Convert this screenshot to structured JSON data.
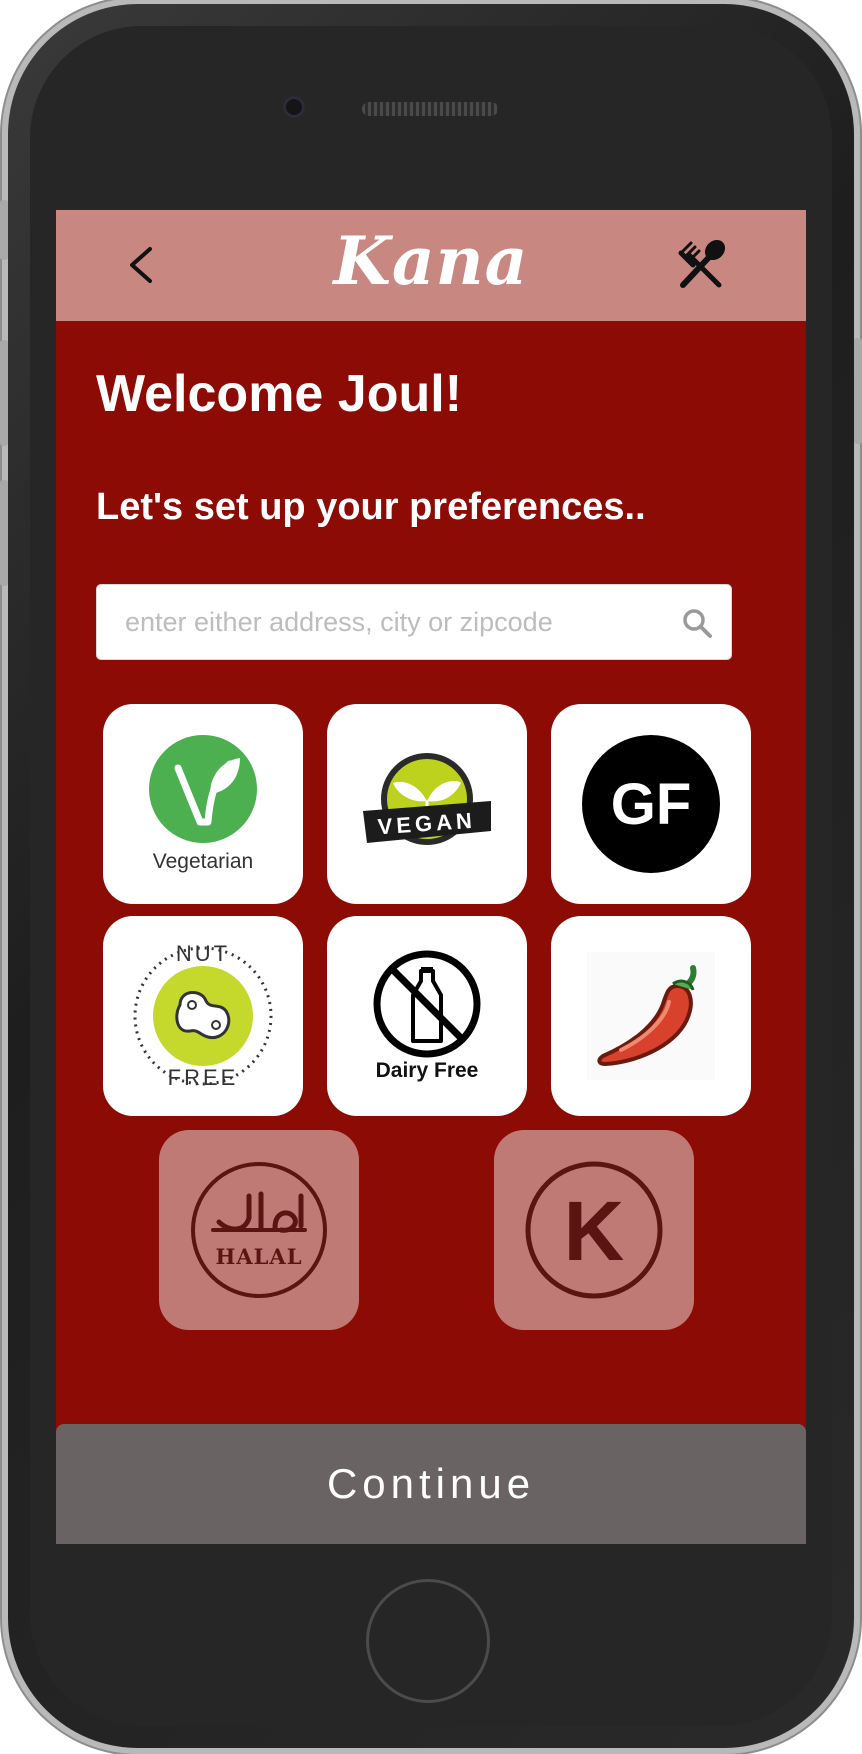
{
  "app": {
    "logo_text": "Kana"
  },
  "header": {
    "back_icon": "chevron-left-icon",
    "menu_icon": "fork-spoon-icon"
  },
  "main": {
    "welcome": "Welcome Joul!",
    "subtitle": "Let's set up your preferences..",
    "search": {
      "value": "",
      "placeholder": "enter either address, city or zipcode",
      "icon": "search-icon"
    },
    "preferences": [
      {
        "id": "vegetarian",
        "label": "Vegetarian",
        "icon": "vegetarian-icon",
        "selected": true
      },
      {
        "id": "vegan",
        "badge_text": "VEGAN",
        "icon": "vegan-icon",
        "selected": true
      },
      {
        "id": "gluten-free",
        "badge_text": "GF",
        "icon": "gluten-free-icon",
        "selected": true
      },
      {
        "id": "nut-free",
        "badge_top": "NUT",
        "badge_bottom": "FREE",
        "icon": "nut-free-icon",
        "selected": true
      },
      {
        "id": "dairy-free",
        "label": "Dairy Free",
        "icon": "dairy-free-icon",
        "selected": true
      },
      {
        "id": "spicy",
        "icon": "chili-pepper-icon",
        "selected": true
      },
      {
        "id": "halal",
        "badge_text": "HALAL",
        "icon": "halal-icon",
        "selected": false
      },
      {
        "id": "kosher",
        "badge_text": "K",
        "icon": "kosher-icon",
        "selected": false
      }
    ]
  },
  "footer": {
    "continue_label": "Continue"
  },
  "colors": {
    "screen_bg": "#8d0b05",
    "header_bg": "#c98782",
    "tile_bg": "#ffffff",
    "tile_dim_bg": "#c07a76",
    "continue_bg": "#6a6363"
  }
}
